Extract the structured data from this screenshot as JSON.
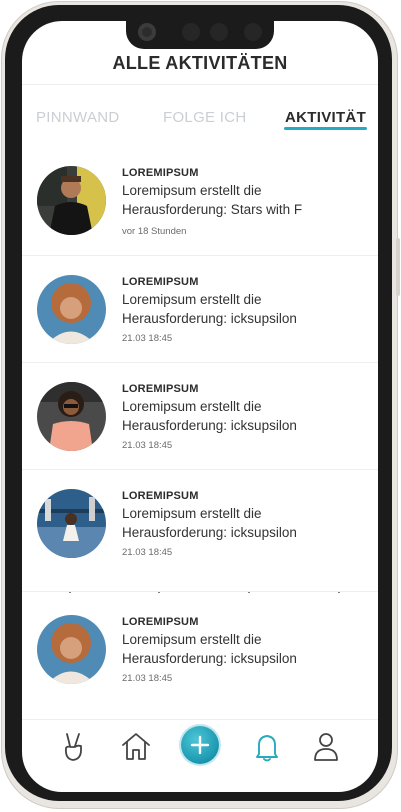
{
  "header": {
    "title": "ALLE AKTIVITÄTEN"
  },
  "tabs": [
    {
      "label": "PINNWAND",
      "active": false
    },
    {
      "label": "FOLGE ICH",
      "active": false
    },
    {
      "label": "AKTIVITÄT",
      "active": true
    }
  ],
  "feed": [
    {
      "name": "LOREMIPSUM",
      "line1": "Loremipsum erstellt die",
      "line2": "Herausforderung: Stars with F",
      "time": "vor 18 Stunden"
    },
    {
      "name": "LOREMIPSUM",
      "line1": "Loremipsum erstellt die",
      "line2": "Herausforderung: icksupsilon",
      "time": "21.03 18:45"
    },
    {
      "name": "LOREMIPSUM",
      "line1": "Loremipsum erstellt die",
      "line2": "Herausforderung: icksupsilon",
      "time": "21.03 18:45"
    },
    {
      "name": "LOREMIPSUM",
      "line1": "Loremipsum erstellt die",
      "line2": "Herausforderung: icksupsilon",
      "time": "21.03 18:45"
    },
    {
      "name": "LOREMIPSUM",
      "line1": "Loremipsum erstellt die",
      "line2": "Herausforderung: icksupsilon",
      "time": "21.03 18:45"
    }
  ],
  "nav": {
    "items": [
      "peace-hand-icon",
      "home-icon",
      "add-icon",
      "bell-icon",
      "profile-icon"
    ],
    "active": "bell-icon"
  },
  "colors": {
    "accent": "#27a9bf",
    "text": "#2b2b2b",
    "inactive_tab": "#c9cfd3"
  }
}
